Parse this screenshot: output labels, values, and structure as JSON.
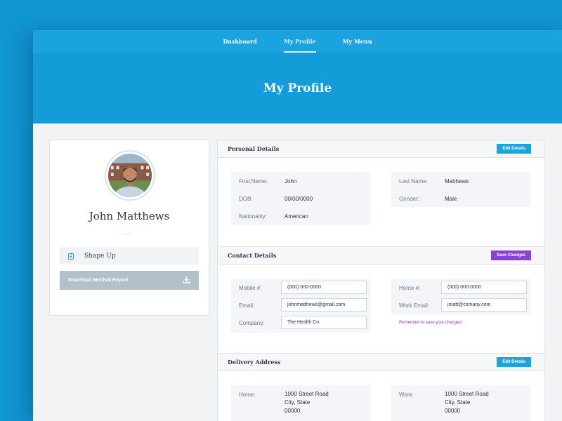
{
  "nav": {
    "tabs": [
      {
        "label": "Dashboard",
        "active": false
      },
      {
        "label": "My Profile",
        "active": true
      },
      {
        "label": "My Menu",
        "active": false
      }
    ]
  },
  "hero": {
    "title": "My Profile"
  },
  "profile": {
    "name": "John Matthews",
    "shape_up_label": "Shape Up",
    "download_label": "Download Medical Report"
  },
  "personal": {
    "title": "Personal Details",
    "button": "Edit Details",
    "first_name_label": "First Name:",
    "first_name": "John",
    "last_name_label": "Last Name:",
    "last_name": "Matthews",
    "dob_label": "DOB:",
    "dob": "00/00/0000",
    "gender_label": "Gender:",
    "gender": "Male",
    "nationality_label": "Nationality:",
    "nationality": "American"
  },
  "contact": {
    "title": "Contact Details",
    "button": "Save Changes",
    "mobile_label": "Mobile #:",
    "mobile": "(000) 000-0000",
    "home_label": "Home #:",
    "home": "(000) 000-0000",
    "email_label": "Email:",
    "email": "johnmatthews@gmail.com",
    "work_email_label": "Work Email:",
    "work_email": "jmatt@comany.com",
    "company_label": "Company:",
    "company": "The Health Co.",
    "hint": "Remember to save your changes!"
  },
  "delivery": {
    "title": "Delivery Address",
    "button": "Edit Details",
    "home_label": "Home:",
    "home_line1": "1000 Street Road",
    "home_line2": "City, State",
    "home_line3": "00000",
    "work_label": "Work:",
    "work_line1": "1000 Street Road",
    "work_line2": "City, State",
    "work_line3": "00000"
  },
  "colors": {
    "background": "#1196d4",
    "nav": "#1aa3de",
    "hero": "#149cd8",
    "accent_blue": "#1ca4dd",
    "accent_purple": "#8e3fd6"
  },
  "icons": {
    "shape_up": "clipboard-icon",
    "download": "download-icon"
  }
}
